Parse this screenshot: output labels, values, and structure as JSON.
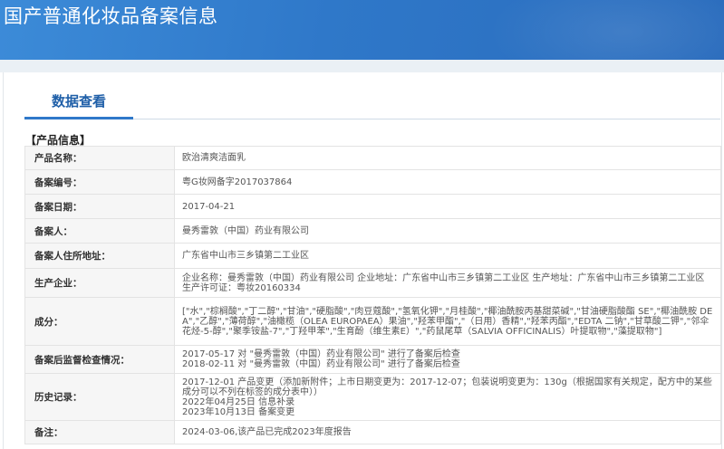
{
  "header": {
    "title": "国产普通化妆品备案信息"
  },
  "tab": {
    "label": "数据查看"
  },
  "section": {
    "title": "【产品信息】"
  },
  "rows": [
    {
      "label": "产品名称：",
      "lines": [
        "欧治清爽洁面乳"
      ]
    },
    {
      "label": "备案编号：",
      "lines": [
        "粤G妆网备字2017037864"
      ]
    },
    {
      "label": "备案日期：",
      "lines": [
        "2017-04-21"
      ]
    },
    {
      "label": "备案人：",
      "lines": [
        "曼秀雷敦（中国）药业有限公司"
      ]
    },
    {
      "label": "备案人住所地址：",
      "lines": [
        "广东省中山市三乡镇第二工业区"
      ]
    },
    {
      "label": "生产企业：",
      "lines": [
        "企业名称：曼秀雷敦（中国）药业有限公司 企业地址：广东省中山市三乡镇第二工业区 生产地址：广东省中山市三乡镇第二工业区 生产许可证：粤妆20160334"
      ]
    },
    {
      "label": "成分：",
      "lines": [
        "[\"水\",\"棕榈酸\",\"丁二醇\",\"甘油\",\"硬脂酸\",\"肉豆蔻酸\",\"氢氧化钾\",\"月桂酸\",\"椰油酰胺丙基甜菜碱\",\"甘油硬脂酸酯 SE\",\"椰油酰胺 DEA\",\"乙醇\",\"薄荷醇\",\"油橄榄（OLEA EUROPAEA）果油\",\"羟苯甲酯\",\"（日用）香精\",\"羟苯丙酯\",\"EDTA 二钠\",\"甘草酸二钾\",\"邻伞花烃-5-醇\",\"聚季铵盐-7\",\"丁羟甲苯\",\"生育酚（维生素E）\",\"药鼠尾草（SALVIA OFFICINALIS）叶提取物\",\"藻提取物\"]"
      ]
    },
    {
      "label": "备案后监督检查情况：",
      "lines": [
        "2017-05-17 对 \"曼秀雷敦（中国）药业有限公司\" 进行了备案后检查",
        "2018-02-11 对 \"曼秀雷敦（中国）药业有限公司\" 进行了备案后检查"
      ]
    },
    {
      "label": "历史记录：",
      "lines": [
        "2017-12-01 产品变更（添加新附件；上市日期变更为：2017-12-07；包装说明变更为：130g（根据国家有关规定，配方中的某些成分可以不列在标签的成分表中））",
        "2022年04月25日 信息补录",
        "2023年10月13日 备案变更"
      ]
    },
    {
      "label": "备注：",
      "lines": [
        "2024-03-06,该产品已完成2023年度报告"
      ]
    }
  ]
}
